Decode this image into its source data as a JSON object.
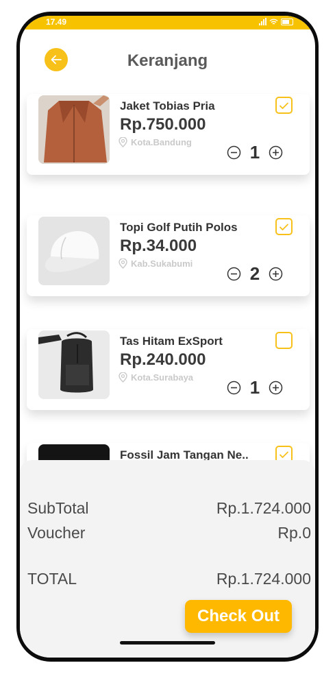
{
  "status": {
    "time": "17.49"
  },
  "header": {
    "title": "Keranjang",
    "back_icon": "arrow-left-icon"
  },
  "colors": {
    "accent": "#F8C11A",
    "checkout": "#FFB800",
    "status_bar": "#F7C300"
  },
  "cart": {
    "items": [
      {
        "name": "Jaket Tobias Pria",
        "price": "Rp.750.000",
        "location": "Kota.Bandung",
        "qty": "1",
        "checked": true,
        "image": "orange-jacket"
      },
      {
        "name": "Topi Golf Putih Polos",
        "price": "Rp.34.000",
        "location": "Kab.Sukabumi",
        "qty": "2",
        "checked": true,
        "image": "white-cap"
      },
      {
        "name": "Tas Hitam ExSport",
        "price": "Rp.240.000",
        "location": "Kota.Surabaya",
        "qty": "1",
        "checked": false,
        "image": "black-backpack"
      },
      {
        "name": "Fossil Jam Tangan Ne..",
        "checked": true,
        "image": "black-watch"
      }
    ]
  },
  "summary": {
    "subtotal_label": "SubTotal",
    "subtotal_value": "Rp.1.724.000",
    "voucher_label": "Voucher",
    "voucher_value": "Rp.0",
    "total_label": "TOTAL",
    "total_value": "Rp.1.724.000",
    "checkout_label": "Check Out"
  }
}
